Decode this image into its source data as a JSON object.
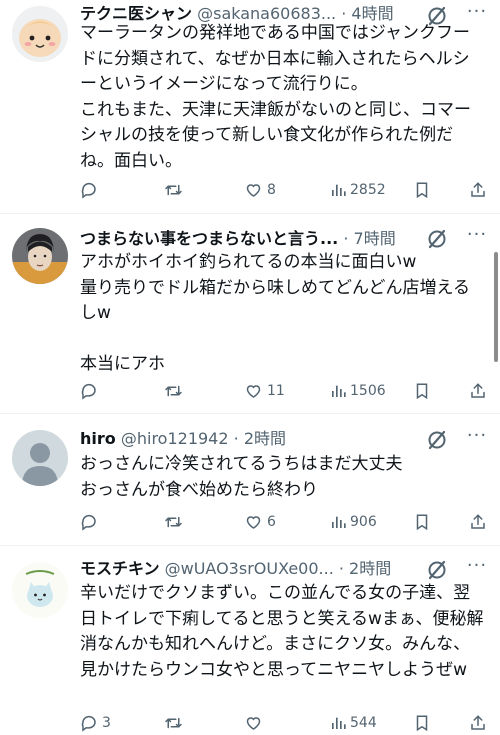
{
  "tweets": [
    {
      "name": "テクニ医シャン",
      "handle": "@sakana60683...",
      "time": "· 4時間",
      "text": "マーラータンの発祥地である中国ではジャンクフードに分類されて、なぜか日本に輸入されたらヘルシーというイメージになって流行りに。\nこれもまた、天津に天津飯がないのと同じ、コマーシャルの技を使って新しい食文化が作られた例だね。面白い。",
      "replies": "",
      "retweets": "",
      "likes": "8",
      "views": "2852"
    },
    {
      "name": "つまらない事をつまらないと言う...",
      "handle": "",
      "time": "· 7時間",
      "text": "アホがホイホイ釣られてるの本当に面白いw\n量り売りでドル箱だから味しめてどんどん店増えるしw\n\n本当にアホ",
      "replies": "",
      "retweets": "",
      "likes": "11",
      "views": "1506"
    },
    {
      "name": "hiro",
      "handle": "@hiro121942",
      "time": "· 2時間",
      "text": "おっさんに冷笑されてるうちはまだ大丈夫\nおっさんが食べ始めたら終わり",
      "replies": "",
      "retweets": "",
      "likes": "6",
      "views": "906"
    },
    {
      "name": "モスチキン",
      "handle": "@wUAO3srOUXe00...",
      "time": "· 2時間",
      "text": "辛いだけでクソまずい。この並んでる女の子達、翌日トイレで下痢してると思うと笑えるwまぁ、便秘解消なんかも知れへんけど。まさにクソ女。みんな、見かけたらウンコ女やと思ってニヤニヤしようぜw",
      "replies": "3",
      "retweets": "",
      "likes": "",
      "views": "544"
    }
  ],
  "colors": {
    "text": "#0f1419",
    "secondary": "#536471",
    "divider": "#eff3f4"
  },
  "icons": [
    "reply-icon",
    "retweet-icon",
    "like-icon",
    "views-icon",
    "bookmark-icon",
    "share-icon",
    "grok-icon",
    "more-icon"
  ]
}
